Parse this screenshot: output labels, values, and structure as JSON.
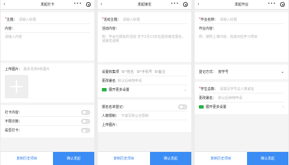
{
  "panel1": {
    "title": "发起打卡",
    "subject_label": "主题",
    "subject_placeholder": "请输入标题",
    "content_label": "内容",
    "content_placeholder": "请输入内容",
    "upload_label": "上传图片",
    "upload_hint": "最多支持9张图片",
    "switches": [
      "打卡内容",
      "不限次数",
      "是否打卡"
    ],
    "history_button": "复制历史项目",
    "confirm_button": "确认发起"
  },
  "panel2": {
    "title": "发起接龙",
    "subject_label": "活动主题",
    "subject_placeholder": "请输入标题",
    "content_label": "活动内容",
    "content_placeholder": "例：学会与朋友的活动 定于2月13日在屋前接龙报名，请接龙说明",
    "collect_label": "设置收集项",
    "collect_options": [
      "*姓名",
      "*手机号",
      "备注"
    ],
    "notes_label": "更改署名",
    "notes_placeholder": "默认后续随申请",
    "more_settings": "展开更多设置",
    "signup_label": "报名名单登记",
    "limit_label": "人数限制",
    "limit_placeholder": "不填写默认无限制",
    "upload_label": "上传图片",
    "history_button": "复制历史项目",
    "confirm_button": "确认发起"
  },
  "panel3": {
    "title": "发起作业",
    "name_label": "作业名称",
    "name_placeholder": "请输入标题",
    "content_label": "作业内容",
    "content_placeholder": "例：按照上课内容，完成对应学习项目",
    "register_label": "登记方式",
    "register_value": "按学号",
    "students_label": "学生总数",
    "students_placeholder": "请填写学号总人数或名",
    "notes_label": "更改署名",
    "notes_placeholder": "默认后续随申请",
    "more_settings": "展开更多设置",
    "history_button": "复制历史项目",
    "confirm_button": "确认发起"
  },
  "icons": {
    "back": "back-arrow-icon",
    "more": "more-dots-icon",
    "target": "target-icon"
  },
  "colors": {
    "accent": "#3b8cf5",
    "link": "#2f7ee6",
    "required": "#e33333",
    "green": "#2bb24c"
  }
}
